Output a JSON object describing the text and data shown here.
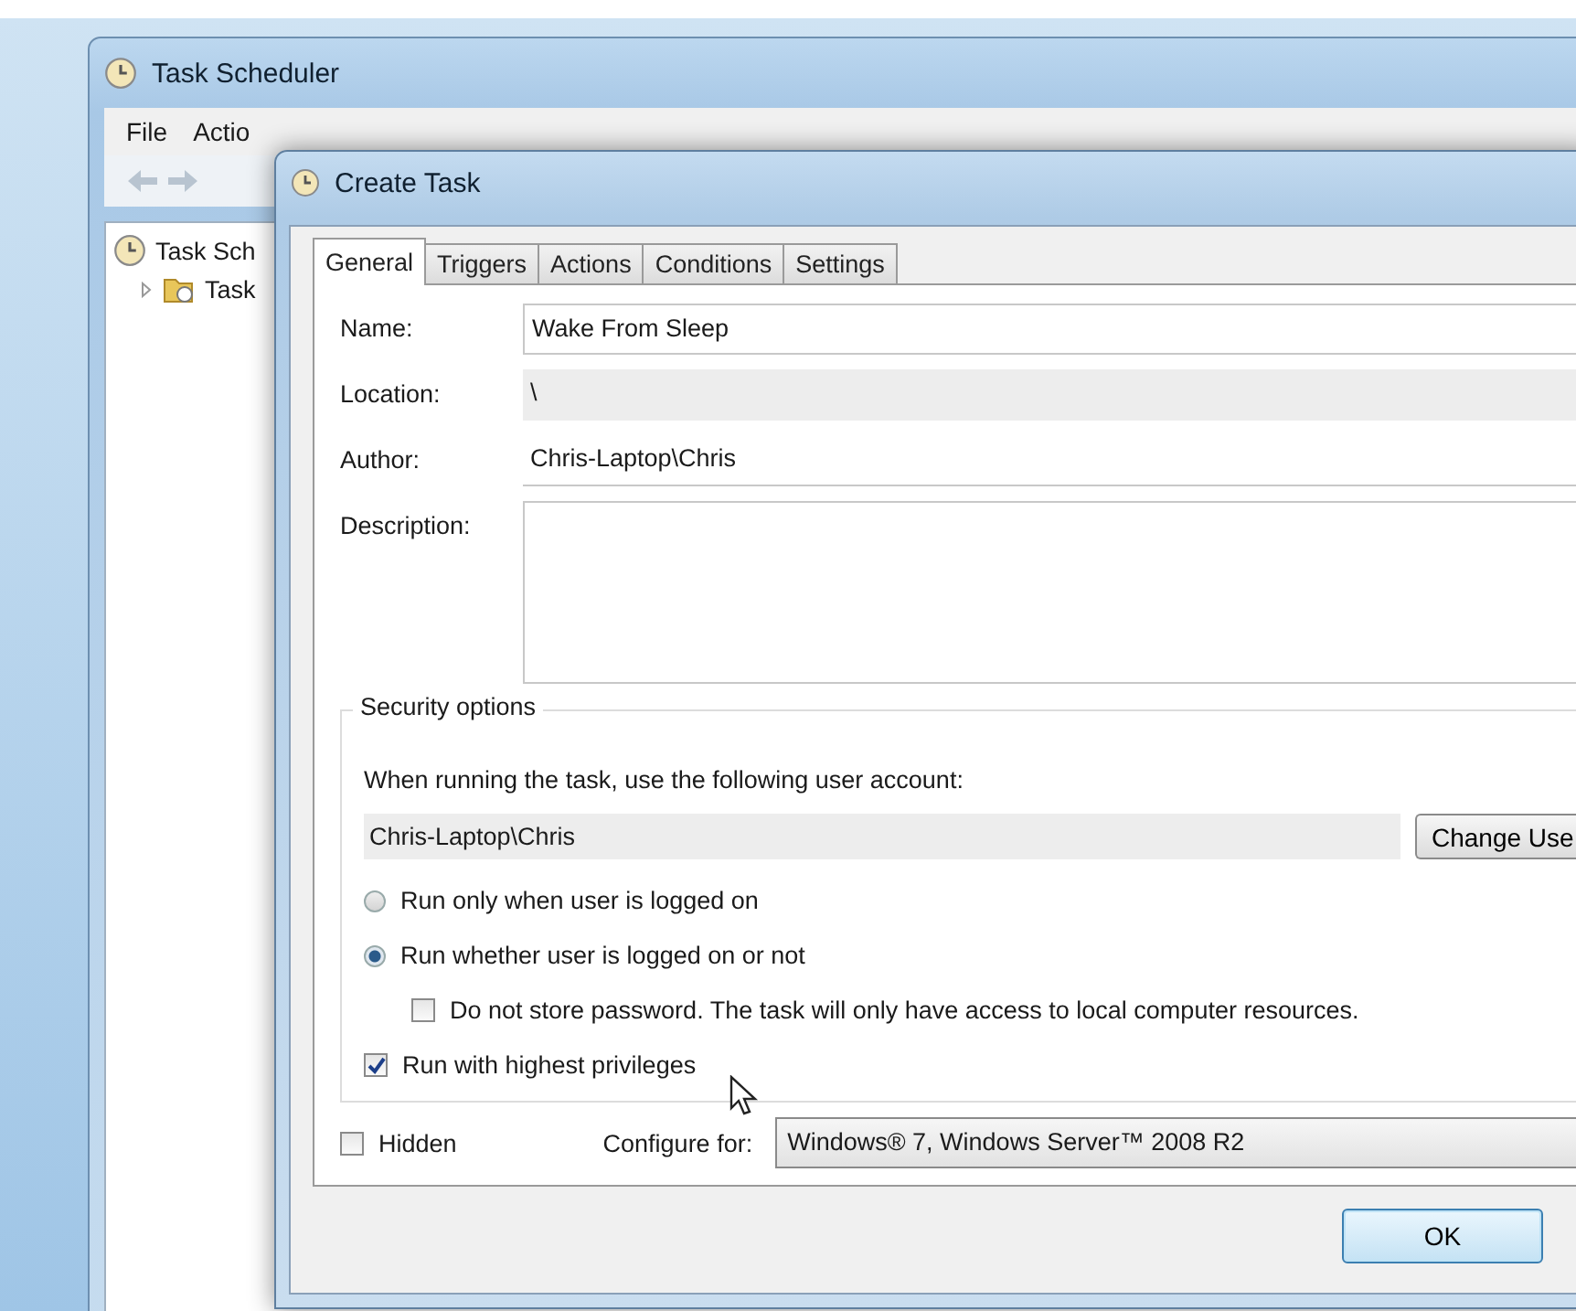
{
  "main_window": {
    "title": "Task Scheduler",
    "menu": [
      "File",
      "Actio"
    ],
    "tree": [
      {
        "label": "Task Sch",
        "children": [
          {
            "label": "Task",
            "expanded": false
          }
        ]
      }
    ]
  },
  "dialog": {
    "title": "Create Task",
    "tabs": [
      {
        "label": "General",
        "selected": true
      },
      {
        "label": "Triggers",
        "selected": false
      },
      {
        "label": "Actions",
        "selected": false
      },
      {
        "label": "Conditions",
        "selected": false
      },
      {
        "label": "Settings",
        "selected": false
      }
    ],
    "fields": [
      {
        "label": "Name:",
        "kind": "input",
        "value": "Wake From Sleep"
      },
      {
        "label": "Location:",
        "kind": "readonly",
        "value": "\\"
      },
      {
        "label": "Author:",
        "kind": "text",
        "value": "Chris-Laptop\\Chris"
      },
      {
        "label": "Description:",
        "kind": "textarea"
      }
    ],
    "security": {
      "title": "Security options",
      "prompt": "When running the task, use the following user account:",
      "account": "Chris-Laptop\\Chris",
      "change_button": "Change Use",
      "options": [
        {
          "kind": "radio",
          "label": "Run only when user is logged on",
          "selected": false
        },
        {
          "kind": "radio",
          "label": "Run whether user is logged on or not",
          "selected": true,
          "children": [
            {
              "kind": "checkbox",
              "label": "Do not store password.  The task will only have access to local computer resources.",
              "checked": false
            }
          ]
        },
        {
          "kind": "checkbox",
          "label": "Run with highest privileges",
          "checked": true
        }
      ]
    },
    "hidden": {
      "label": "Hidden",
      "checked": false
    },
    "configure": {
      "label": "Configure for:",
      "value": "Windows® 7, Windows Server™ 2008 R2"
    },
    "buttons": [
      "OK"
    ]
  }
}
